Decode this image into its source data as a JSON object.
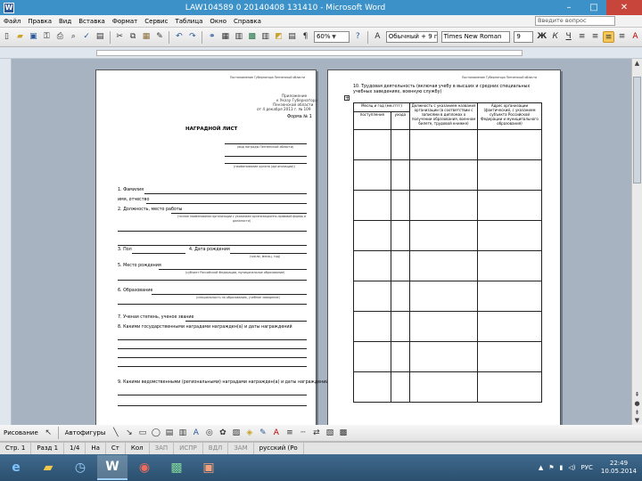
{
  "window": {
    "title": "LAW104589 0 20140408 131410 - Microsoft Word",
    "controls": {
      "minimize": "–",
      "maximize": "□",
      "close": "✕"
    }
  },
  "menubar": {
    "items": [
      "Файл",
      "Правка",
      "Вид",
      "Вставка",
      "Формат",
      "Сервис",
      "Таблица",
      "Окно",
      "Справка"
    ],
    "help_placeholder": "Введите вопрос"
  },
  "toolbar": {
    "zoom": "60%",
    "style": "Обычный + 9 пт, Г",
    "font": "Times New Roman",
    "size": "9",
    "bold": "Ж",
    "italic": "К",
    "underline": "Ч"
  },
  "document": {
    "page1": {
      "header_note": "Постановление Губернатора Пензенской области",
      "approval": [
        "Приложение",
        "к Указу Губернатора",
        "Пензенской области",
        "от 4 декабря 2013 г. № 109"
      ],
      "form": "Форма № 1",
      "heading": "НАГРАДНОЙ ЛИСТ",
      "caption_award": "(вид награды Пензенской области)",
      "caption_org": "(наименование органа (организации))",
      "f1": "1. Фамилия",
      "f_name": "имя, отчество",
      "f2": "2. Должность, место работы",
      "caption_position": "(точное наименование организации с указанием организационно-правовой формы и должности)",
      "f3": "3. Пол",
      "f4": "4. Дата рождения",
      "caption_date": "(число, месяц, год)",
      "f5": "5. Место рождения",
      "caption_birth": "(субъект Российской Федерации, муниципальное образование)",
      "f6": "6. Образование",
      "caption_edu": "(специальность по образованию, учебное заведение)",
      "f7": "7. Ученая степень, ученое звание",
      "f8": "8. Какими государственными наградами награжден(а) и даты награждений",
      "f9": "9. Какими ведомственными (региональными) наградами награжден(а) и даты награждений"
    },
    "page2": {
      "header_note": "Постановление Губернатора Пензенской области",
      "intro": "10. Трудовая деятельность (включая учебу в высших и средних специальных учебных заведениях, военную службу)",
      "table_headers": {
        "month_year": "Месяц и год (мм.гггг)",
        "entry": "поступления",
        "exit": "ухода",
        "position": "Должность с указанием названия организации (в соответствии с записями в дипломах о получении образования, военном билете, трудовой книжке)",
        "address": "Адрес организации (фактический, с указанием субъекта Российской Федерации и муниципального образования)"
      }
    }
  },
  "drawbar": {
    "draw": "Рисование",
    "autoshapes": "Автофигуры"
  },
  "status": {
    "page": "Стр. 1",
    "section": "Разд 1",
    "pages": "1/4",
    "at": "На",
    "line": "Ст",
    "col": "Кол",
    "rec": "ЗАП",
    "trk": "ИСПР",
    "ext": "ВДЛ",
    "ovr": "ЗАМ",
    "lang": "русский (Ро"
  },
  "taskbar": {
    "time": "22:49",
    "date": "10.05.2014",
    "lang": "РУС"
  }
}
